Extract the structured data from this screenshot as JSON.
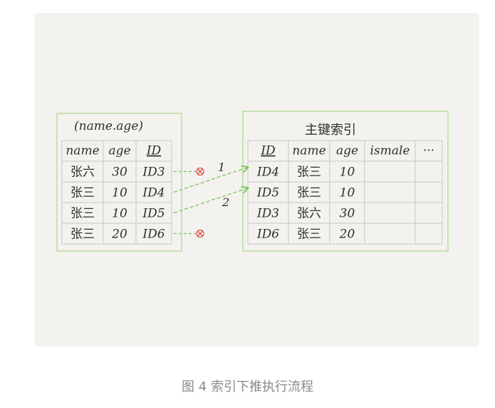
{
  "index_box": {
    "title": "(name.age)",
    "headers": [
      "name",
      "age",
      "ID"
    ],
    "rows": [
      [
        "张六",
        "30",
        "ID3"
      ],
      [
        "张三",
        "10",
        "ID4"
      ],
      [
        "张三",
        "10",
        "ID5"
      ],
      [
        "张三",
        "20",
        "ID6"
      ]
    ]
  },
  "pk_box": {
    "title": "主键索引",
    "headers": [
      "ID",
      "name",
      "age",
      "ismale",
      "···"
    ],
    "rows": [
      [
        "ID4",
        "张三",
        "10",
        "",
        ""
      ],
      [
        "ID5",
        "张三",
        "10",
        "",
        ""
      ],
      [
        "ID3",
        "张六",
        "30",
        "",
        ""
      ],
      [
        "ID6",
        "张三",
        "20",
        "",
        ""
      ]
    ]
  },
  "arrows": [
    {
      "from_row": 0,
      "type": "rejected"
    },
    {
      "from_row": 1,
      "to_row": 0,
      "label": "1"
    },
    {
      "from_row": 2,
      "to_row": 1,
      "label": "2"
    },
    {
      "from_row": 3,
      "type": "rejected"
    }
  ],
  "colors": {
    "box_border": "#b7dc9c",
    "grid": "#cfcfcf",
    "arrow": "#7cc35a",
    "reject": "#e0504a"
  },
  "caption": "图 4 索引下推执行流程"
}
